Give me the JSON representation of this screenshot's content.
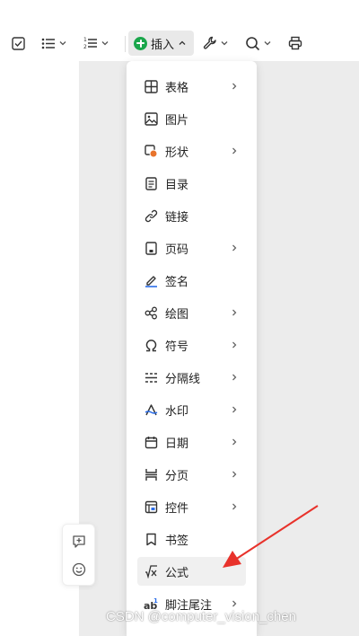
{
  "toolbar": {
    "insert_label": "插入",
    "icons": [
      "checkbox-icon",
      "bullet-list-icon",
      "numbered-list-icon",
      "insert-plus-icon",
      "wrench-icon",
      "search-icon",
      "print-icon"
    ]
  },
  "menu": {
    "items": [
      {
        "label": "表格",
        "icon": "table-icon",
        "has_submenu": true
      },
      {
        "label": "图片",
        "icon": "image-icon",
        "has_submenu": false
      },
      {
        "label": "形状",
        "icon": "shape-icon",
        "has_submenu": true
      },
      {
        "label": "目录",
        "icon": "toc-icon",
        "has_submenu": false
      },
      {
        "label": "链接",
        "icon": "link-icon",
        "has_submenu": false
      },
      {
        "label": "页码",
        "icon": "page-number-icon",
        "has_submenu": true
      },
      {
        "label": "签名",
        "icon": "signature-icon",
        "has_submenu": false
      },
      {
        "label": "绘图",
        "icon": "drawing-icon",
        "has_submenu": true
      },
      {
        "label": "符号",
        "icon": "omega-icon",
        "has_submenu": true
      },
      {
        "label": "分隔线",
        "icon": "divider-icon",
        "has_submenu": true
      },
      {
        "label": "水印",
        "icon": "watermark-icon",
        "has_submenu": true
      },
      {
        "label": "日期",
        "icon": "calendar-icon",
        "has_submenu": true
      },
      {
        "label": "分页",
        "icon": "page-break-icon",
        "has_submenu": true
      },
      {
        "label": "控件",
        "icon": "control-icon",
        "has_submenu": true
      },
      {
        "label": "书签",
        "icon": "bookmark-icon",
        "has_submenu": false
      },
      {
        "label": "公式",
        "icon": "formula-icon",
        "has_submenu": false,
        "highlighted": true
      },
      {
        "label": "脚注尾注",
        "icon": "footnote-icon",
        "has_submenu": true
      }
    ]
  },
  "sidebar": {
    "icons": [
      "comment-add-icon",
      "emoji-icon"
    ]
  },
  "annotation": {
    "color": "#e8322b"
  },
  "watermark": "CSDN @computer_vision_chen",
  "colors": {
    "accent": "#1aa64b",
    "menu_highlight": "#f0f0f0",
    "canvas": "#ececec"
  }
}
